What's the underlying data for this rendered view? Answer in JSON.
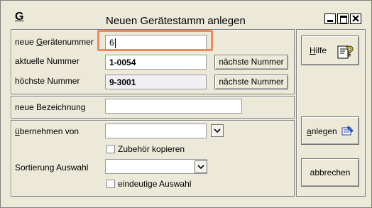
{
  "window": {
    "title": "Neuen Gerätestamm anlegen",
    "app_icon_letter": "G"
  },
  "form": {
    "neue_geraetenummer": {
      "label": "neue Gerätenummer",
      "value": "6"
    },
    "aktuelle_nummer": {
      "label": "aktuelle Nummer",
      "value": "1-0054",
      "button": "nächste Nummer"
    },
    "hoechste_nummer": {
      "label": "höchste Nummer",
      "value": "9-3001",
      "button": "nächste Nummer"
    },
    "neue_bezeichnung": {
      "label": "neue Bezeichnung",
      "value": ""
    },
    "uebernehmen_von": {
      "label": "übernehmen von",
      "value": ""
    },
    "zubehoer_kopieren": {
      "label": "Zubehör kopieren",
      "checked": false
    },
    "sortierung_auswahl": {
      "label": "Sortierung Auswahl",
      "value": ""
    },
    "eindeutige_auswahl": {
      "label": "eindeutige Auswahl",
      "checked": false
    }
  },
  "buttons": {
    "hilfe": "Hilfe",
    "anlegen": "anlegen",
    "abbrechen": "abbrechen"
  },
  "icons": {
    "help": "help-icon",
    "create": "create-icon",
    "minimize": "minimize-icon",
    "maximize": "maximize-icon",
    "close": "close-icon"
  }
}
